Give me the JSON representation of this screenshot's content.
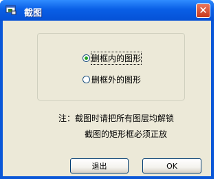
{
  "window": {
    "title": "截图"
  },
  "options": [
    {
      "label": "删框内的图形",
      "checked": true
    },
    {
      "label": "删框外的图形",
      "checked": false
    }
  ],
  "note": {
    "line1": "注：截图时请把所有图层均解锁",
    "line2": "截图的矩形框必须正放"
  },
  "buttons": {
    "exit": "退出",
    "ok": "OK"
  },
  "icons": {
    "app": "app-window-icon",
    "close": "close-icon"
  },
  "colors": {
    "titlebar": "#0a5fe6",
    "client": "#ece9d8",
    "close": "#c8381c"
  }
}
